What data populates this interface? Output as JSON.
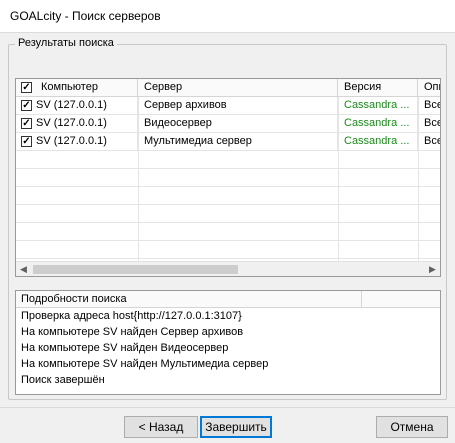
{
  "window": {
    "title": "GOALcity - Поиск серверов"
  },
  "results": {
    "group_label": "Результаты поиска",
    "columns": [
      "Компьютер",
      "Сервер",
      "Версия",
      "Опи"
    ],
    "header_checked": true,
    "rows": [
      {
        "checked": true,
        "computer": "SV (127.0.0.1)",
        "server": "Сервер архивов",
        "version": "Cassandra ...",
        "desc": "Все"
      },
      {
        "checked": true,
        "computer": "SV (127.0.0.1)",
        "server": "Видеосервер",
        "version": "Cassandra ...",
        "desc": "Все"
      },
      {
        "checked": true,
        "computer": "SV (127.0.0.1)",
        "server": "Мультимедиа сервер",
        "version": "Cassandra ...",
        "desc": "Все"
      }
    ]
  },
  "details": {
    "header": "Подробности поиска",
    "lines": [
      "Проверка адреса host{http://127.0.0.1:3107}",
      "На компьютере SV найден Сервер архивов",
      "На компьютере SV найден Видеосервер",
      "На компьютере SV найден Мультимедиа сервер",
      "Поиск завершён"
    ]
  },
  "buttons": {
    "back": "< Назад",
    "finish": "Завершить",
    "cancel": "Отмена"
  },
  "colors": {
    "version_text": "#1b8a1b",
    "focus_border": "#0078d7"
  }
}
